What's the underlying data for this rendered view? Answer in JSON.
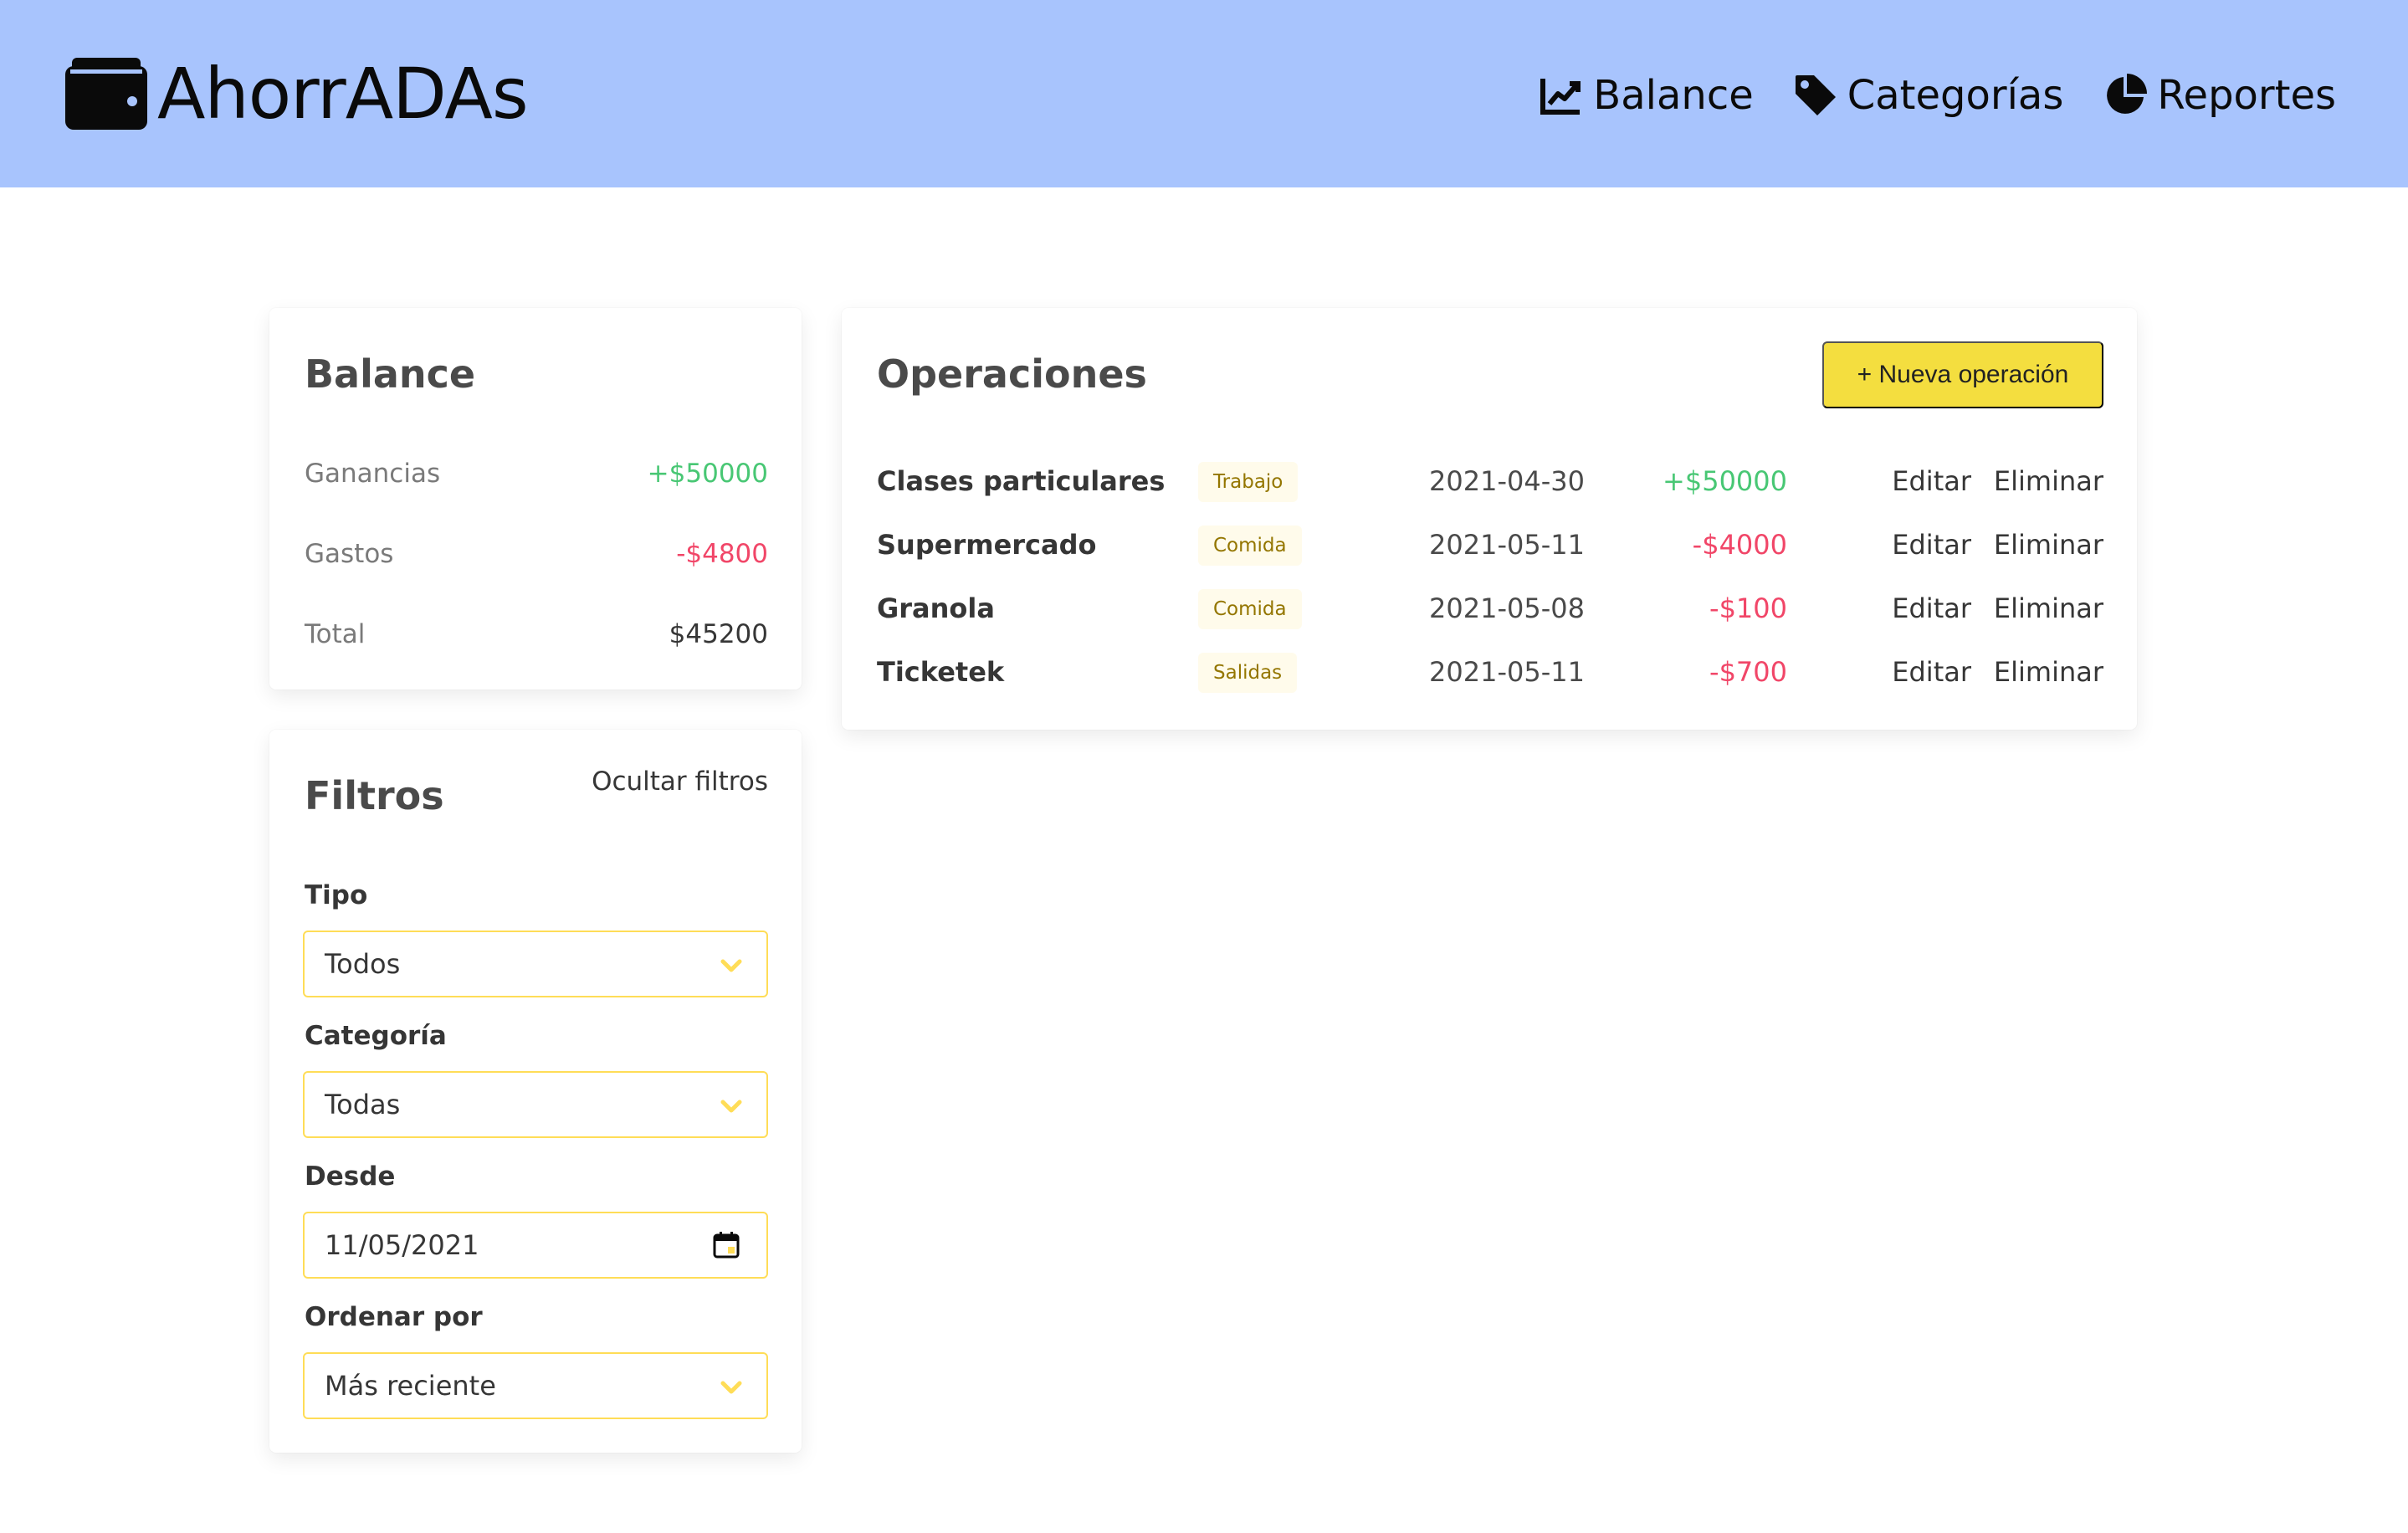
{
  "app": {
    "title": "AhorrADAs"
  },
  "nav": {
    "items": [
      {
        "label": "Balance",
        "icon": "chart-line-icon"
      },
      {
        "label": "Categorías",
        "icon": "tag-icon"
      },
      {
        "label": "Reportes",
        "icon": "pie-chart-icon"
      }
    ]
  },
  "balance": {
    "title": "Balance",
    "rows": [
      {
        "label": "Ganancias",
        "value": "+$50000"
      },
      {
        "label": "Gastos",
        "value": "-$4800"
      },
      {
        "label": "Total",
        "value": "$45200"
      }
    ]
  },
  "filters": {
    "title": "Filtros",
    "hide_label": "Ocultar filtros",
    "tipo": {
      "label": "Tipo",
      "value": "Todos"
    },
    "categoria": {
      "label": "Categoría",
      "value": "Todas"
    },
    "desde": {
      "label": "Desde",
      "value": "11/05/2021"
    },
    "orden": {
      "label": "Ordenar por",
      "value": "Más reciente"
    }
  },
  "operations": {
    "title": "Operaciones",
    "new_button": "+ Nueva operación",
    "edit_label": "Editar",
    "delete_label": "Eliminar",
    "rows": [
      {
        "description": "Clases particulares",
        "category": "Trabajo",
        "date": "2021-04-30",
        "amount": "+$50000",
        "type": "ganancia"
      },
      {
        "description": "Supermercado",
        "category": "Comida",
        "date": "2021-05-11",
        "amount": "-$4000",
        "type": "gasto"
      },
      {
        "description": "Granola",
        "category": "Comida",
        "date": "2021-05-08",
        "amount": "-$100",
        "type": "gasto"
      },
      {
        "description": "Ticketek",
        "category": "Salidas",
        "date": "2021-05-11",
        "amount": "-$700",
        "type": "gasto"
      }
    ]
  },
  "colors": {
    "header_bg": "#a8c4fd",
    "positive": "#48c774",
    "negative": "#f14668",
    "accent_button": "#f4de3f",
    "input_border": "#ffdd57",
    "tag_bg": "#fffbeb",
    "tag_text": "#947600"
  }
}
